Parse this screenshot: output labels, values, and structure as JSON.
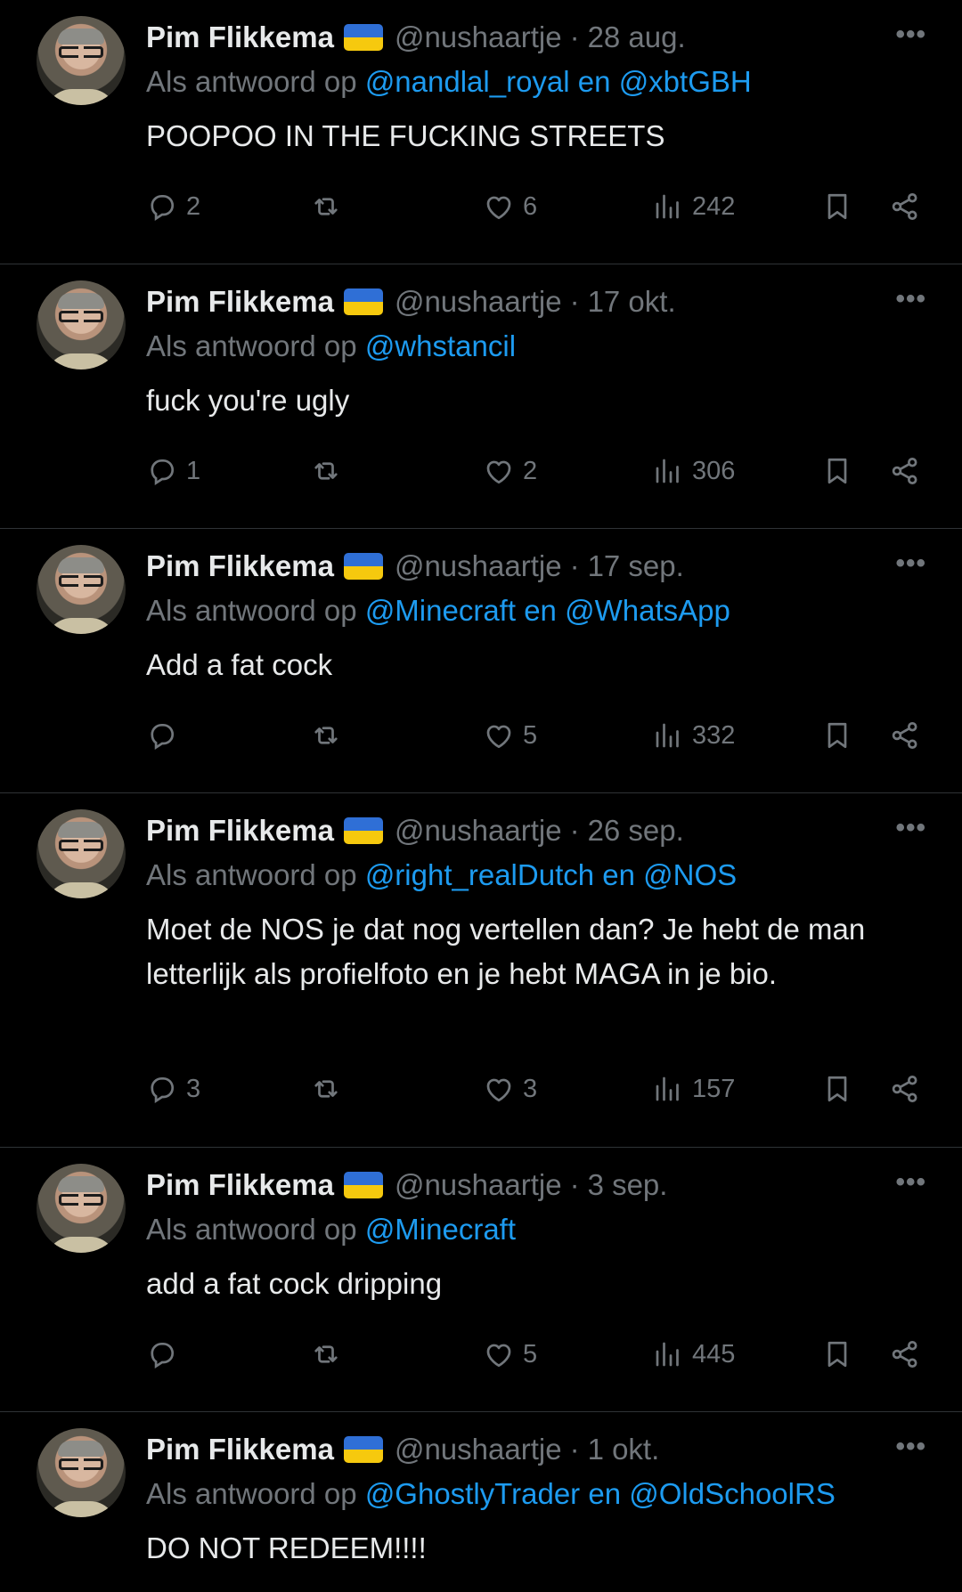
{
  "reply_prefix": "Als antwoord op",
  "flag_icon": "ukraine-flag-icon",
  "tweets": [
    {
      "name": "Pim Flikkema",
      "handle": "@nushaartje",
      "sep": "·",
      "date": "28 aug.",
      "mention1": "@nandlal_royal",
      "conj": "en",
      "mention2": "@xbtGBH",
      "text": "POOPOO IN THE FUCKING STREETS",
      "replies": "2",
      "reposts": "",
      "likes": "6",
      "views": "242"
    },
    {
      "name": "Pim Flikkema",
      "handle": "@nushaartje",
      "sep": "·",
      "date": "17 okt.",
      "mention1": "@whstancil",
      "conj": "",
      "mention2": "",
      "text": "fuck you're ugly",
      "replies": "1",
      "reposts": "",
      "likes": "2",
      "views": "306"
    },
    {
      "name": "Pim Flikkema",
      "handle": "@nushaartje",
      "sep": "·",
      "date": "17 sep.",
      "mention1": "@Minecraft",
      "conj": "en",
      "mention2": "@WhatsApp",
      "text": "Add a fat cock",
      "replies": "",
      "reposts": "",
      "likes": "5",
      "views": "332"
    },
    {
      "name": "Pim Flikkema",
      "handle": "@nushaartje",
      "sep": "·",
      "date": "26 sep.",
      "mention1": "@right_realDutch",
      "conj": "en",
      "mention2": "@NOS",
      "text": "Moet de NOS je dat nog vertellen dan? Je hebt de man letterlijk als profielfoto en je hebt MAGA in je bio.",
      "replies": "3",
      "reposts": "",
      "likes": "3",
      "views": "157"
    },
    {
      "name": "Pim Flikkema",
      "handle": "@nushaartje",
      "sep": "·",
      "date": "3 sep.",
      "mention1": "@Minecraft",
      "conj": "",
      "mention2": "",
      "text": "add a fat cock dripping",
      "replies": "",
      "reposts": "",
      "likes": "5",
      "views": "445"
    },
    {
      "name": "Pim Flikkema",
      "handle": "@nushaartje",
      "sep": "·",
      "date": "1 okt.",
      "mention1": "@GhostlyTrader",
      "conj": "en",
      "mention2": "@OldSchoolRS",
      "text": "DO NOT REDEEM!!!!",
      "replies": "",
      "reposts": "",
      "likes": "",
      "views": ""
    }
  ],
  "colors": {
    "background": "#000000",
    "text": "#e7e9ea",
    "muted": "#71767b",
    "link": "#1d9bf0",
    "divider": "#2f3336"
  }
}
